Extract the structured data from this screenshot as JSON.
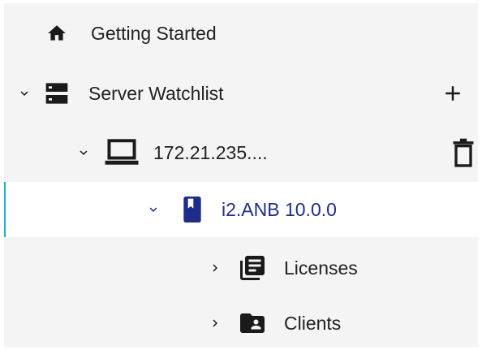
{
  "tree": {
    "items": [
      {
        "label": "Getting Started",
        "icon": "home-icon",
        "chevron": "none"
      },
      {
        "label": "Server Watchlist",
        "icon": "server-icon",
        "chevron": "down",
        "action_icon": "plus-icon"
      },
      {
        "label": "172.21.235....",
        "icon": "laptop-icon",
        "chevron": "down",
        "action_icon": "trash-icon"
      },
      {
        "label": "i2.ANB 10.0.0",
        "icon": "book-icon",
        "chevron": "down",
        "selected": true
      },
      {
        "label": "Licenses",
        "icon": "licenses-icon",
        "chevron": "right"
      },
      {
        "label": "Clients",
        "icon": "clients-folder-icon",
        "chevron": "right"
      }
    ]
  },
  "colors": {
    "row_background": "#f4f4f4",
    "selected_text": "#1f2d8a",
    "selected_accent": "#1bb0ce",
    "text": "#222222",
    "icon": "#1a1a1a"
  }
}
